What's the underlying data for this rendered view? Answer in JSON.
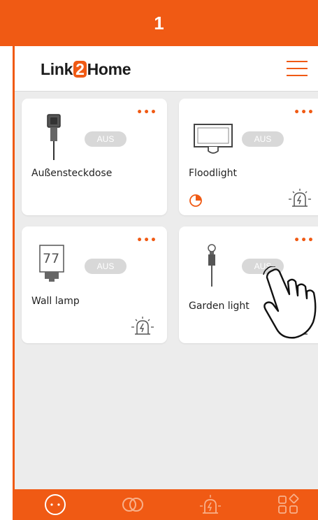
{
  "step": "1",
  "app": {
    "logo_prefix": "Link",
    "logo_digit": "2",
    "logo_suffix": "Home"
  },
  "devices": [
    {
      "name": "Außensteckdose",
      "status": "AUS",
      "icon": "outdoor-socket-icon"
    },
    {
      "name": "Floodlight",
      "status": "AUS",
      "icon": "floodlight-icon"
    },
    {
      "name": "Wall lamp",
      "status": "AUS",
      "icon": "wall-lamp-icon",
      "display": "77"
    },
    {
      "name": "Garden light",
      "status": "AUS",
      "icon": "garden-light-icon"
    }
  ],
  "nav": [
    "home-icon",
    "link-icon",
    "alarm-icon",
    "apps-icon"
  ],
  "colors": {
    "accent": "#f05a14",
    "toggle_off": "#d8d8d8",
    "background": "#ececec"
  }
}
